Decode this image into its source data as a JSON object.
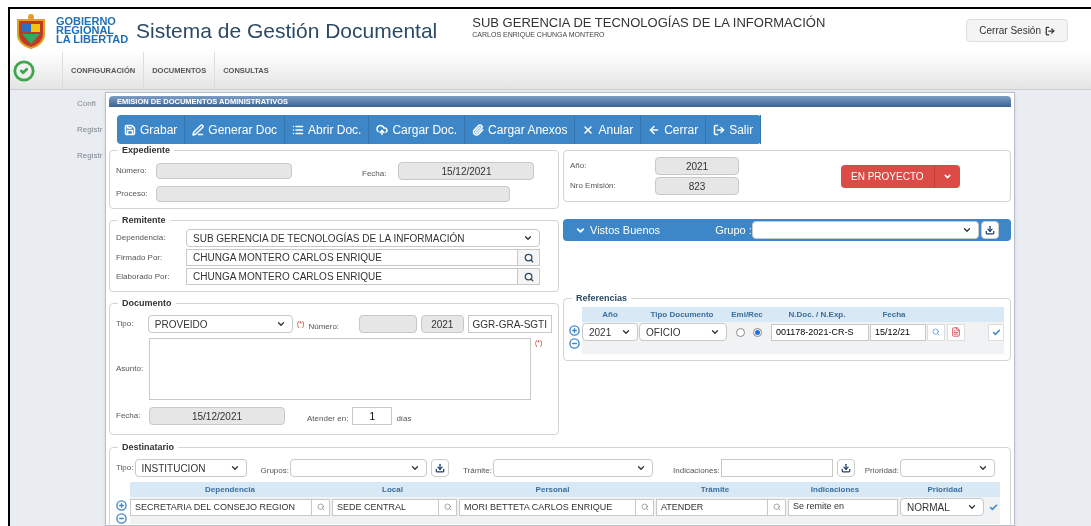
{
  "header": {
    "logo_lines": [
      "GOBIERNO",
      "REGIONAL",
      "LA LIBERTAD"
    ],
    "app_title": "Sistema de Gestión Documental",
    "unit": "SUB GERENCIA DE TECNOLOGÍAS DE LA INFORMACIÓN",
    "user": "CARLOS ENRIQUE CHUNGA MONTERO",
    "logout": "Cerrar Sesión"
  },
  "menu": [
    {
      "label": "CONFIGURACIÓN"
    },
    {
      "label": "DOCUMENTOS"
    },
    {
      "label": "CONSULTAS"
    }
  ],
  "sidebar_items": [
    "Confi",
    "Registr",
    "Registr"
  ],
  "dialog": {
    "title": "EMISION DE DOCUMENTOS ADMINISTRATIVOS",
    "toolbar": [
      {
        "label": "Grabar",
        "kind": "save"
      },
      {
        "label": "Generar Doc",
        "kind": "generate"
      },
      {
        "label": "Abrir Doc.",
        "kind": "open"
      },
      {
        "label": "Cargar Doc.",
        "kind": "upload"
      },
      {
        "label": "Cargar Anexos",
        "kind": "attach"
      },
      {
        "label": "Anular",
        "kind": "cancel"
      },
      {
        "label": "Cerrar",
        "kind": "back"
      },
      {
        "label": "Salir",
        "kind": "exit"
      }
    ]
  },
  "expediente": {
    "legend": "Expediente",
    "numero_label": "Número:",
    "fecha_label": "Fecha:",
    "fecha": "15/12/2021",
    "proceso_label": "Proceso:"
  },
  "emision": {
    "anio_label": "Año:",
    "anio": "2021",
    "nro_label": "Nro Emisión:",
    "nro": "823",
    "status": "EN PROYECTO"
  },
  "remitente": {
    "legend": "Remitente",
    "fields": [
      {
        "label": "Dependencia:",
        "value": "SUB GERENCIA DE TECNOLOGÍAS DE LA INFORMACIÓN",
        "kind": "select"
      },
      {
        "label": "Firmado Por:",
        "value": "CHUNGA MONTERO CARLOS ENRIQUE",
        "kind": "search"
      },
      {
        "label": "Elaborado Por:",
        "value": "CHUNGA MONTERO CARLOS ENRIQUE",
        "kind": "search"
      }
    ]
  },
  "documento": {
    "legend": "Documento",
    "tipo_label": "Tipo:",
    "tipo": "PROVEIDO",
    "required": "(*)",
    "numero_label": "Número:",
    "anio": "2021",
    "sigla": "GGR-GRA-SGTI",
    "asunto_label": "Asunto:",
    "asunto_required": "(*)",
    "fecha_label": "Fecha:",
    "fecha": "15/12/2021",
    "atender_label": "Atender en:",
    "atender": "1",
    "dias": "días"
  },
  "vistos_buenos": {
    "title": "Vistos Buenos",
    "expanded": true,
    "grupo_label": "Grupo :"
  },
  "referencias": {
    "legend": "Referencias",
    "columns": [
      "Año",
      "Tipo Documento",
      "Emi/Rec",
      "N.Doc. / N.Exp.",
      "Fecha"
    ],
    "rows": [
      {
        "anio": "2021",
        "tipo": "OFICIO",
        "emi_rec": [
          {
            "selected": false
          },
          {
            "selected": true
          }
        ],
        "ndoc": "001178-2021-CR-S",
        "fecha": "15/12/21"
      }
    ]
  },
  "destinatario": {
    "legend": "Destinatario",
    "tipo_label": "Tipo:",
    "tipo": "INSTITUCION",
    "grupos_label": "Grupos:",
    "tramite_label": "Trámite:",
    "indicaciones_label": "Indicaciones:",
    "prioridad_label": "Prioridad:",
    "columns": [
      "Dependencia",
      "Local",
      "Personal",
      "Trámite",
      "Indicaciones",
      "Prioridad"
    ],
    "rows": [
      {
        "dependencia": "SECRETARIA  DEL CONSEJO REGION",
        "local": "SEDE CENTRAL",
        "personal": "MORI BETTETA CARLOS ENRIQUE",
        "tramite": "ATENDER",
        "indicaciones": "Se remite en",
        "prioridad": "NORMAL"
      }
    ]
  }
}
